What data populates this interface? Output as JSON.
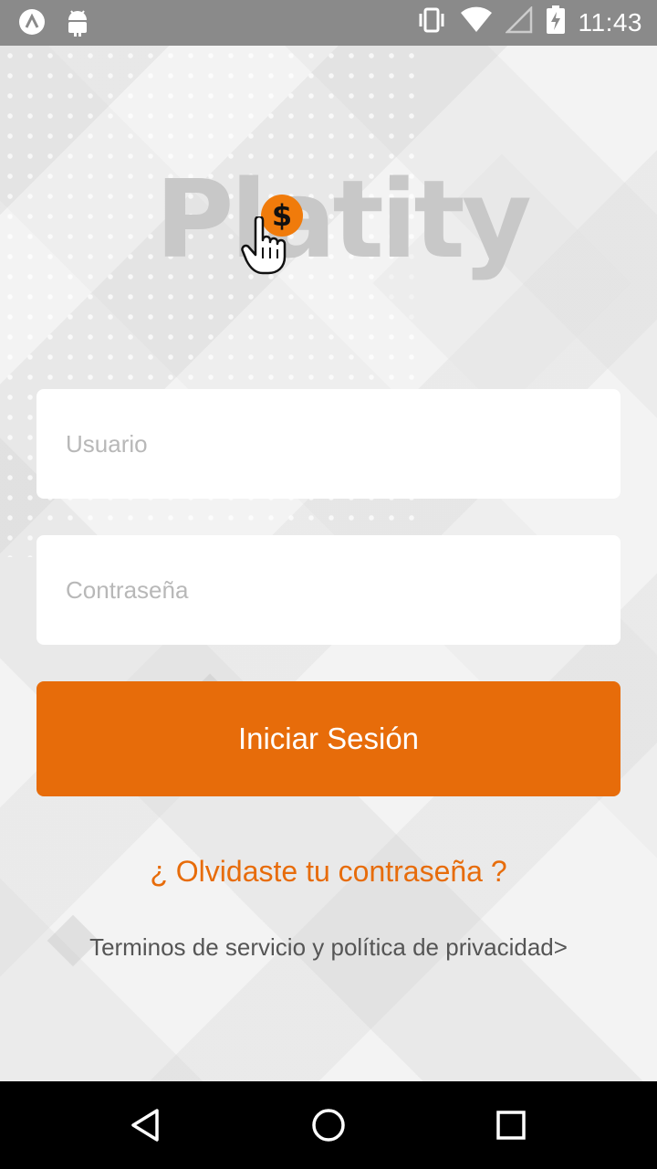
{
  "status_bar": {
    "time": "11:43",
    "left_icons": [
      "notification-a-icon",
      "android-icon"
    ],
    "right_icons": [
      "vibrate-icon",
      "wifi-icon",
      "no-signal-icon",
      "battery-charging-icon"
    ]
  },
  "app": {
    "logo_text": "Platity",
    "coin_symbol": "$",
    "brand_color": "#e76c0a"
  },
  "login_form": {
    "username_placeholder": "Usuario",
    "username_value": "",
    "password_placeholder": "Contraseña",
    "password_value": "",
    "submit_label": "Iniciar Sesión",
    "forgot_label": "¿ Olvidaste tu contraseña ?",
    "terms_label": "Terminos de servicio y política de privacidad>"
  },
  "nav_bar": {
    "buttons": [
      "back-icon",
      "home-icon",
      "recents-icon"
    ]
  }
}
